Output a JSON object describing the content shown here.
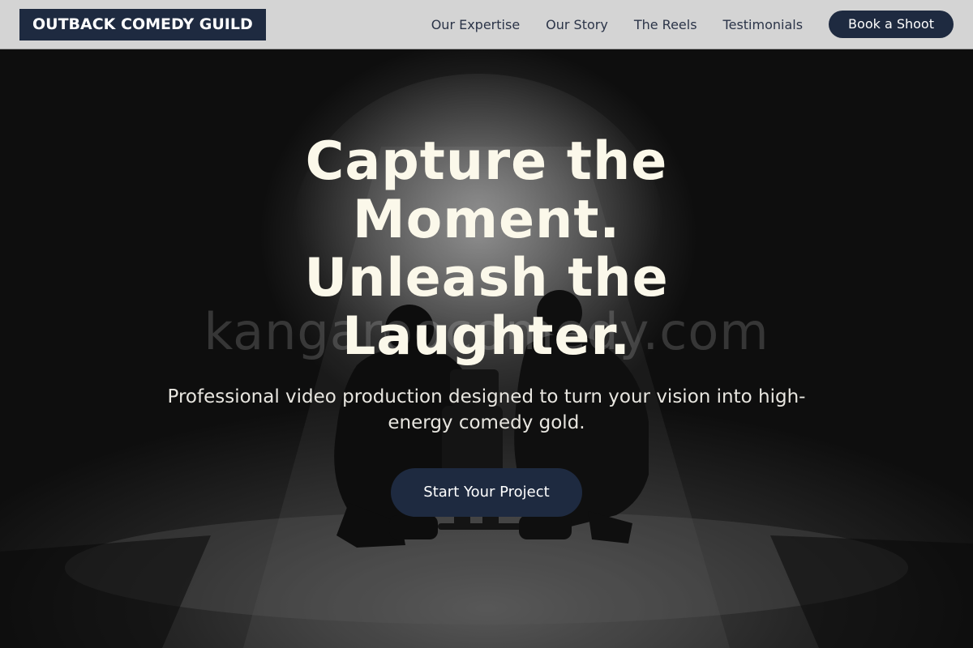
{
  "header": {
    "logo": "OUTBACK COMEDY GUILD",
    "nav": [
      {
        "label": "Our Expertise"
      },
      {
        "label": "Our Story"
      },
      {
        "label": "The Reels"
      },
      {
        "label": "Testimonials"
      }
    ],
    "cta_label": "Book a Shoot"
  },
  "hero": {
    "watermark": "kangaroocomedy.com",
    "title": "Capture the Moment. Unleash the Laughter.",
    "subtitle": "Professional video production designed to turn your vision into high-energy comedy gold.",
    "cta_label": "Start Your Project",
    "background_image": "two-camera-operators-silhouette-on-stage"
  },
  "colors": {
    "navy": "#1e2a40",
    "header_bg": "#d4d4d4",
    "title": "#fbf8ea"
  }
}
